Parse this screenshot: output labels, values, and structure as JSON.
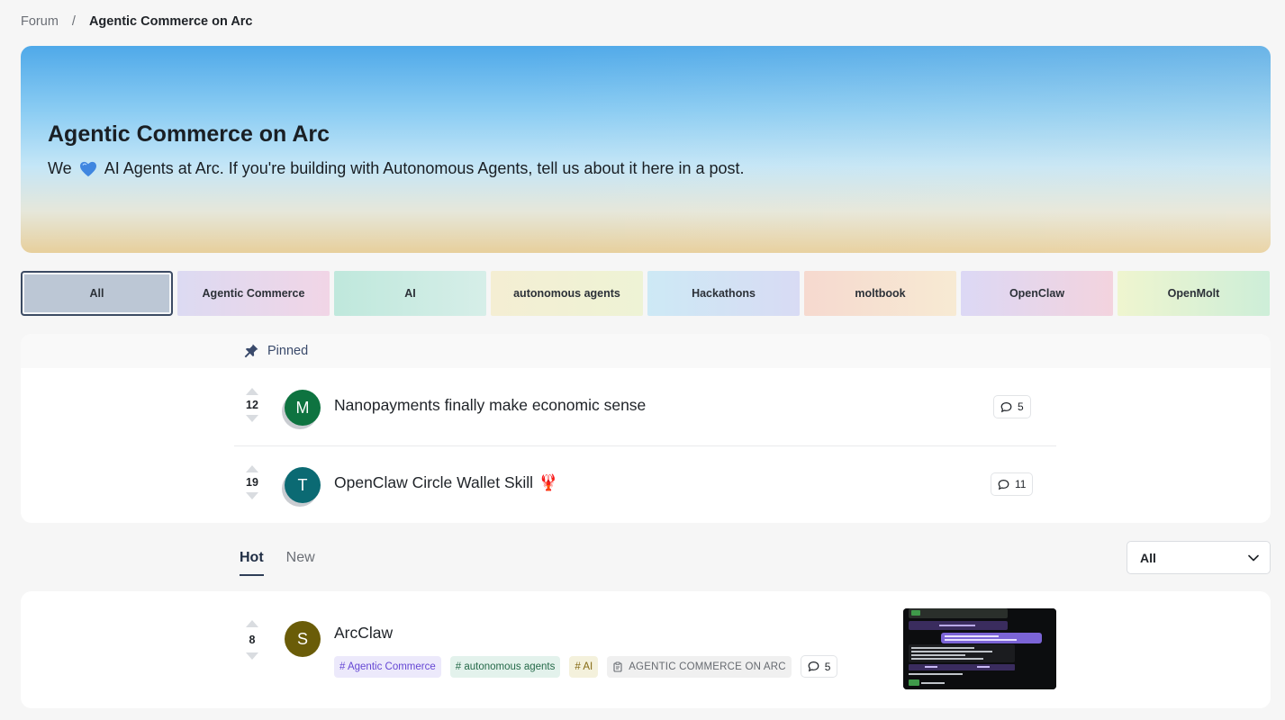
{
  "breadcrumb": {
    "root": "Forum",
    "separator": "/",
    "current": "Agentic Commerce on Arc"
  },
  "hero": {
    "title": "Agentic Commerce on Arc",
    "description_before": "We",
    "description_after": "AI Agents at Arc. If you're building with Autonomous Agents, tell us about it here in a post."
  },
  "category_tabs": [
    {
      "label": "All",
      "active": true
    },
    {
      "label": "Agentic Commerce",
      "active": false
    },
    {
      "label": "AI",
      "active": false
    },
    {
      "label": "autonomous agents",
      "active": false
    },
    {
      "label": "Hackathons",
      "active": false
    },
    {
      "label": "moltbook",
      "active": false
    },
    {
      "label": "OpenClaw",
      "active": false
    },
    {
      "label": "OpenMolt",
      "active": false
    }
  ],
  "pinned": {
    "label": "Pinned",
    "posts": [
      {
        "votes": "12",
        "avatar_letter": "M",
        "avatar_color": "#0e7340",
        "title": "Nanopayments finally make economic sense",
        "comments": "5"
      },
      {
        "votes": "19",
        "avatar_letter": "T",
        "avatar_color": "#0b6a73",
        "title": "OpenClaw Circle Wallet Skill",
        "title_emoji": "🦞",
        "comments": "11"
      }
    ]
  },
  "sort": {
    "tabs": [
      "Hot",
      "New"
    ],
    "active": "Hot"
  },
  "filter": {
    "selected": "All"
  },
  "feed": [
    {
      "votes": "8",
      "avatar_letter": "S",
      "avatar_color": "#6a5c08",
      "title": "ArcClaw",
      "tags": [
        "# Agentic Commerce",
        "# autonomous agents",
        "# AI"
      ],
      "board": "AGENTIC COMMERCE ON ARC",
      "comments": "5"
    }
  ],
  "colors": {
    "accent": "#2f3e57",
    "page_bg": "#f6f6f6",
    "card_bg": "#ffffff"
  },
  "icons": {
    "pin": "pin-icon",
    "heart": "blue-heart-icon",
    "comment": "comment-bubble-icon",
    "chevron": "chevron-down-icon",
    "clipboard": "clipboard-icon"
  }
}
